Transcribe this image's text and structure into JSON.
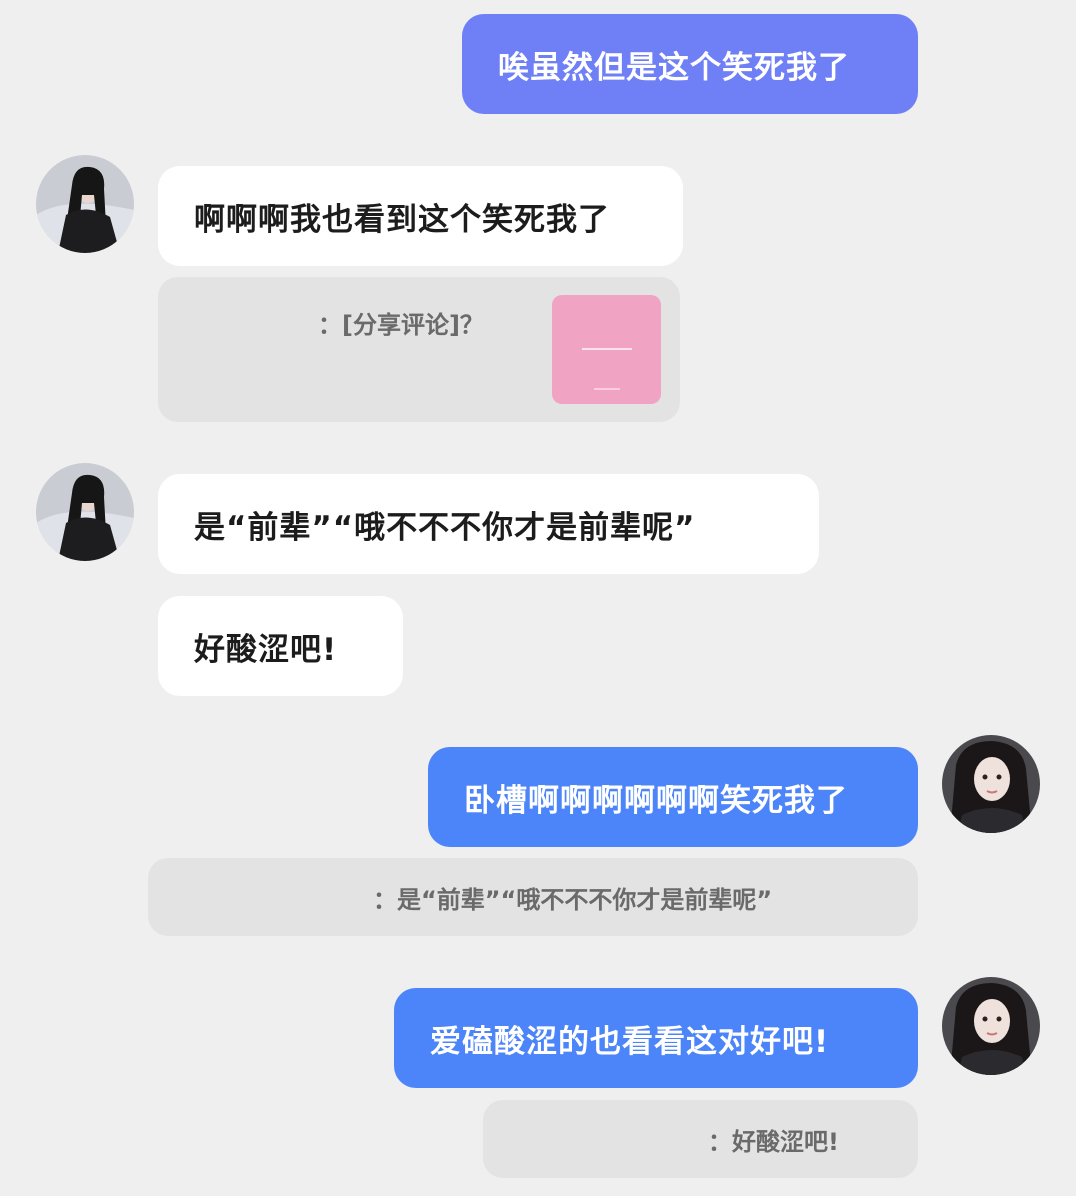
{
  "messages": {
    "m1": "唉虽然但是这个笑死我了",
    "m2": "啊啊啊我也看到这个笑死我了",
    "m2_quote": "：[分享评论]？",
    "m3": "是“前辈”“哦不不不你才是前辈呢”",
    "m4": "好酸涩吧!",
    "m5": "卧槽啊啊啊啊啊啊笑死我了",
    "m5_quote": "：是“前辈”“哦不不不你才是前辈呢”",
    "m6": "爱磕酸涩的也看看这对好吧!",
    "m6_quote": "：好酸涩吧!"
  },
  "colors": {
    "background": "#efefef",
    "incoming_bubble": "#ffffff",
    "outgoing_bubble_1": "#6f7ff5",
    "outgoing_bubble_2": "#4c84f9",
    "quote_bubble": "#e3e3e3",
    "shared_thumbnail": "#f1a3c4"
  },
  "icons": {
    "left_avatar": "avatar-girl-dark-hair-snow",
    "right_avatar": "avatar-girl-selfie",
    "shared_thumbnail": "pink-image-thumbnail"
  }
}
